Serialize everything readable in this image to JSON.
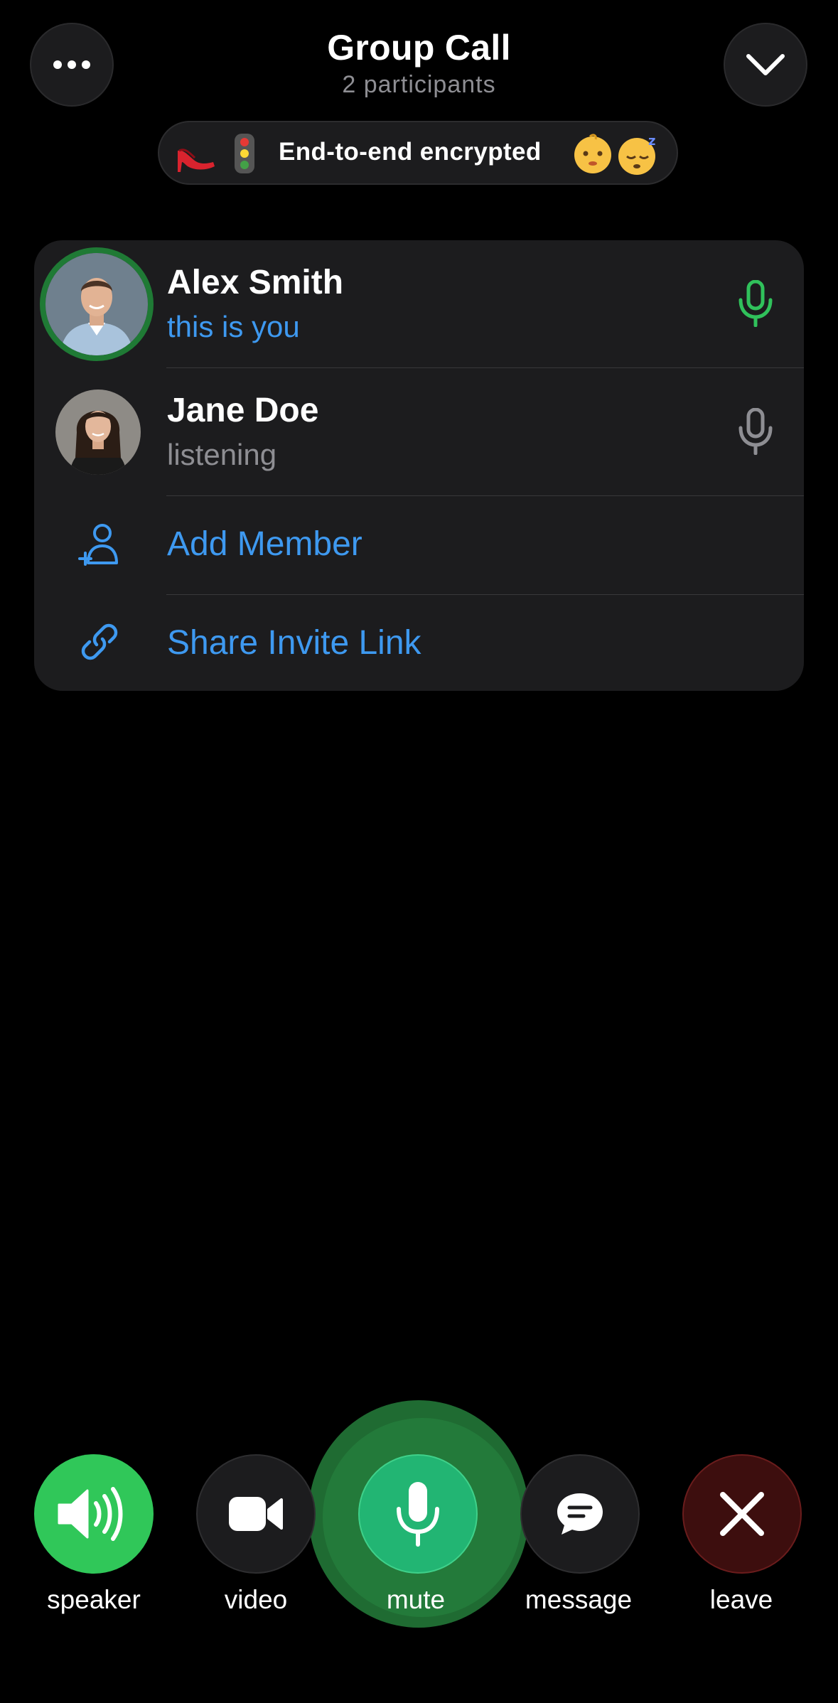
{
  "header": {
    "title": "Group Call",
    "subtitle": "2 participants",
    "more_icon": "ellipsis-icon",
    "collapse_icon": "chevron-down-icon"
  },
  "encryption": {
    "label": "End-to-end encrypted",
    "emojis": [
      "high-heel-shoe",
      "traffic-light",
      "baby-face",
      "sleeping-face"
    ]
  },
  "participants": [
    {
      "name": "Alex Smith",
      "status": "this is you",
      "status_color": "#3e99f0",
      "speaking": true,
      "mic_color": "#30c15b"
    },
    {
      "name": "Jane Doe",
      "status": "listening",
      "status_color": "#8e8e93",
      "speaking": false,
      "mic_color": "#8e8e93"
    }
  ],
  "actions": [
    {
      "label": "Add Member",
      "icon": "add-person-icon"
    },
    {
      "label": "Share Invite Link",
      "icon": "link-icon"
    }
  ],
  "controls": [
    {
      "label": "speaker",
      "icon": "speaker-icon",
      "color": "#30c759"
    },
    {
      "label": "video",
      "icon": "video-camera-icon",
      "color": "#1c1c1e"
    },
    {
      "label": "mute",
      "icon": "microphone-icon",
      "color": "#22b573"
    },
    {
      "label": "message",
      "icon": "message-icon",
      "color": "#1c1c1e"
    },
    {
      "label": "leave",
      "icon": "close-icon",
      "color": "#3d0e0e"
    }
  ],
  "colors": {
    "accent": "#3e99f0",
    "speaking_green": "#30c15b",
    "background": "#000000"
  }
}
